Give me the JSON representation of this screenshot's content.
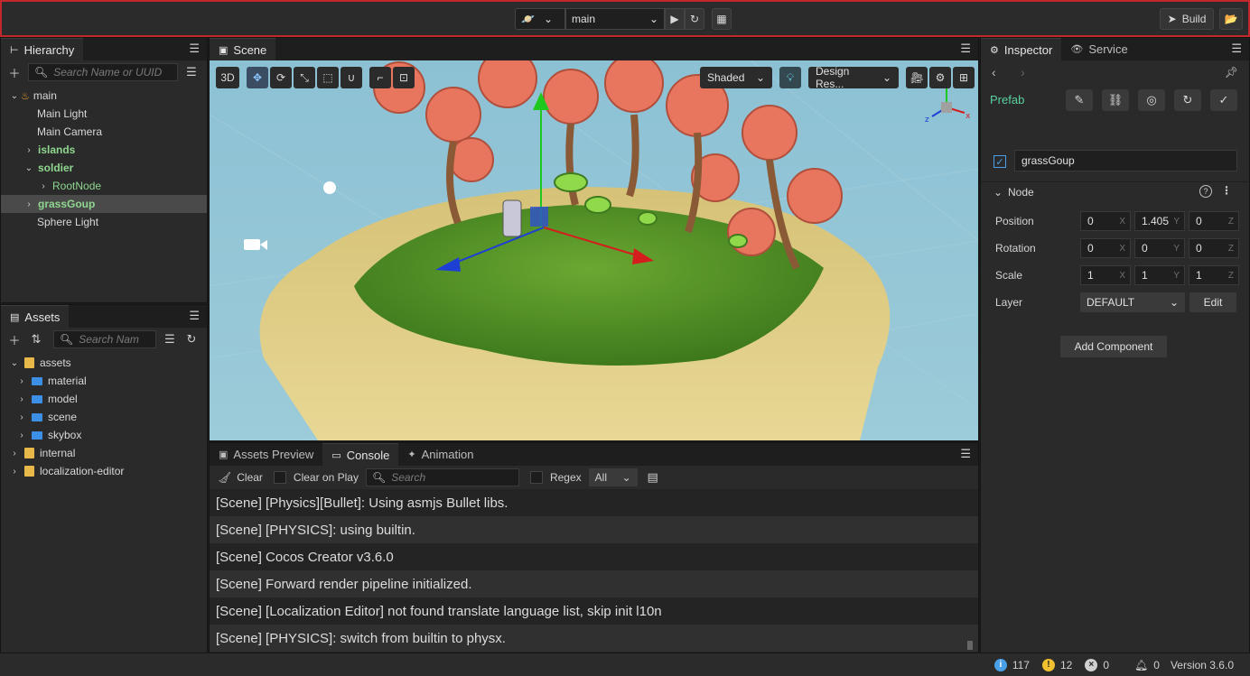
{
  "toolbar": {
    "scene_select": "main",
    "build_label": "Build"
  },
  "hierarchy": {
    "tab": "Hierarchy",
    "search_placeholder": "Search Name or UUID",
    "nodes": [
      {
        "label": "main",
        "level": 0,
        "arrow": "down",
        "icon": "fire-icon"
      },
      {
        "label": "Main Light",
        "level": 1
      },
      {
        "label": "Main Camera",
        "level": 1
      },
      {
        "label": "islands",
        "level": 1,
        "arrow": "right",
        "style": "green-bold"
      },
      {
        "label": "soldier",
        "level": 1,
        "arrow": "down",
        "style": "green-bold"
      },
      {
        "label": "RootNode",
        "level": 2,
        "arrow": "right",
        "style": "green"
      },
      {
        "label": "grassGoup",
        "level": 1,
        "arrow": "right",
        "style": "green-bold",
        "selected": true
      },
      {
        "label": "Sphere Light",
        "level": 1
      }
    ]
  },
  "assets": {
    "tab": "Assets",
    "search_placeholder": "Search Nam",
    "items": [
      {
        "label": "assets",
        "level": 0,
        "arrow": "down",
        "icon": "db"
      },
      {
        "label": "material",
        "level": 1,
        "arrow": "right",
        "icon": "folder"
      },
      {
        "label": "model",
        "level": 1,
        "arrow": "right",
        "icon": "folder"
      },
      {
        "label": "scene",
        "level": 1,
        "arrow": "right",
        "icon": "folder"
      },
      {
        "label": "skybox",
        "level": 1,
        "arrow": "right",
        "icon": "folder"
      },
      {
        "label": "internal",
        "level": 0,
        "arrow": "right",
        "icon": "db"
      },
      {
        "label": "localization-editor",
        "level": 0,
        "arrow": "right",
        "icon": "db"
      }
    ]
  },
  "scene": {
    "tab": "Scene",
    "btn_3d": "3D",
    "shading": "Shaded",
    "resolution": "Design Res..."
  },
  "console": {
    "tabs": [
      "Assets Preview",
      "Console",
      "Animation"
    ],
    "clear_label": "Clear",
    "clear_on_play_label": "Clear on Play",
    "search_placeholder": "Search",
    "regex_label": "Regex",
    "filter": "All",
    "lines": [
      "[Scene] [Physics][Bullet]: Using asmjs Bullet libs.",
      "[Scene] [PHYSICS]: using builtin.",
      "[Scene] Cocos Creator v3.6.0",
      "[Scene] Forward render pipeline initialized.",
      "[Scene] [Localization Editor] not found translate language list, skip init l10n",
      "[Scene] [PHYSICS]: switch from builtin to physx."
    ]
  },
  "inspector": {
    "tabs": [
      "Inspector",
      "Service"
    ],
    "prefab_label": "Prefab",
    "node_name": "grassGoup",
    "section_label": "Node",
    "position_label": "Position",
    "rotation_label": "Rotation",
    "scale_label": "Scale",
    "layer_label": "Layer",
    "position": [
      "0",
      "1.405",
      "0"
    ],
    "rotation": [
      "0",
      "0",
      "0"
    ],
    "scale": [
      "1",
      "1",
      "1"
    ],
    "layer": "DEFAULT",
    "edit_label": "Edit",
    "add_component_label": "Add Component"
  },
  "status": {
    "info_count": "117",
    "warn_count": "12",
    "error_count": "0",
    "notify_count": "0",
    "version": "Version 3.6.0"
  }
}
